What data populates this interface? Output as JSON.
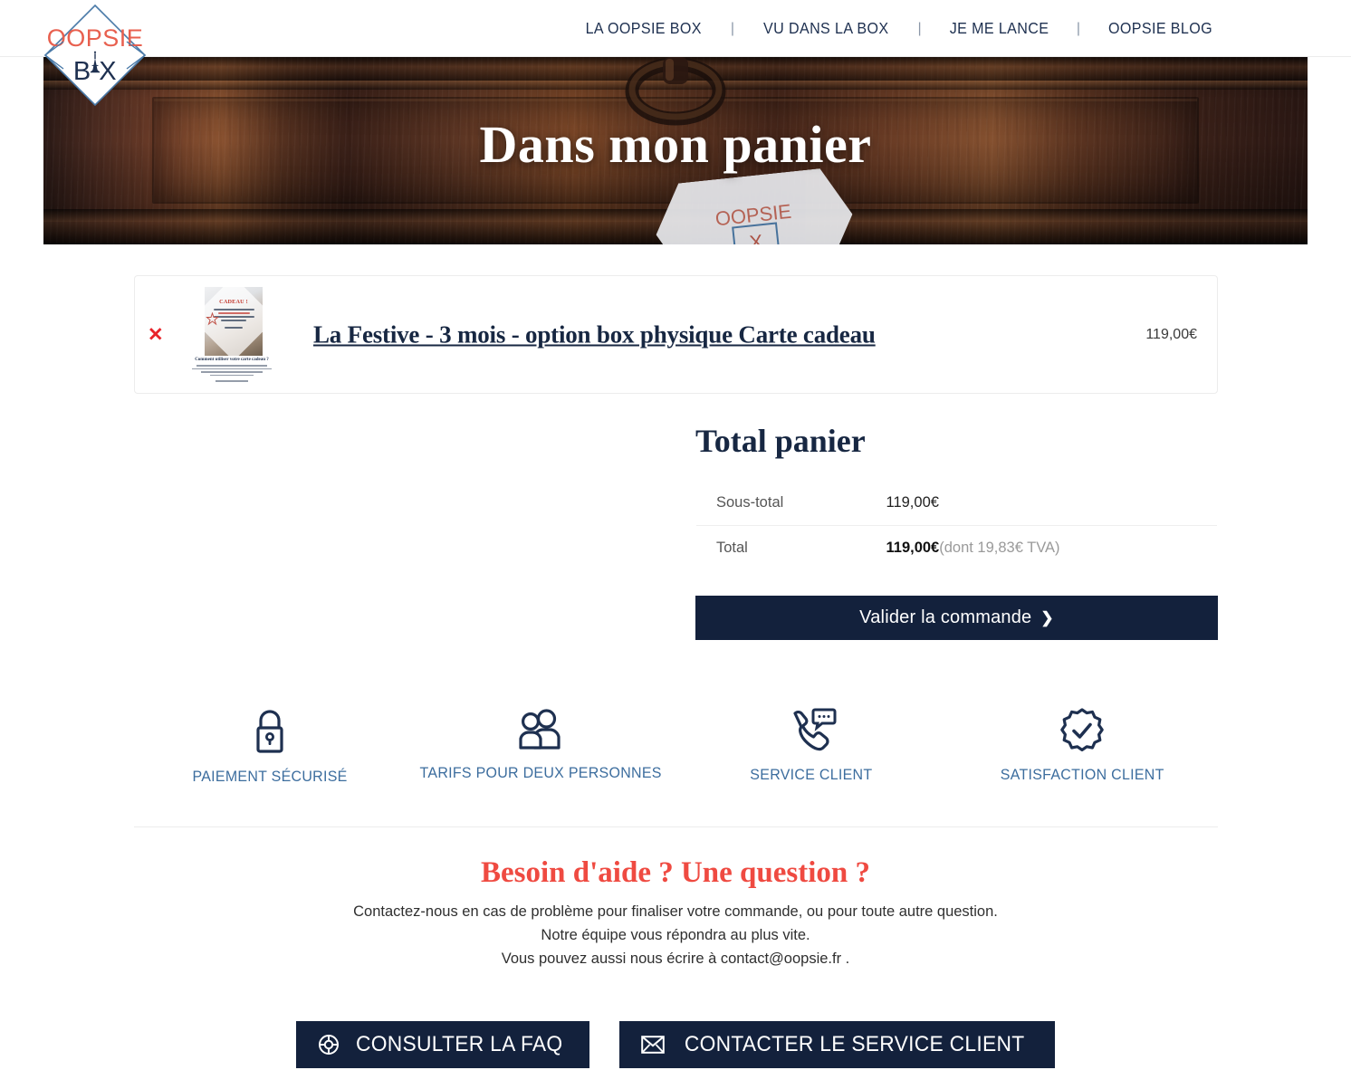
{
  "header": {
    "logo": {
      "top_text": "OOPSIE",
      "bottom_text": "BOX",
      "icon": "eiffel-tower-icon"
    },
    "nav": [
      {
        "label": "LA OOPSIE BOX"
      },
      {
        "label": "VU DANS LA BOX"
      },
      {
        "label": "JE ME LANCE"
      },
      {
        "label": "OOPSIE BLOG"
      }
    ],
    "nav_separator": "|"
  },
  "hero": {
    "title": "Dans mon panier"
  },
  "cart": {
    "remove_label": "✕",
    "item": {
      "title": "La Festive - 3 mois - option box physique Carte cadeau",
      "price": "119,00€",
      "thumbnail": {
        "headline": "CADEAU !",
        "footer_title": "Comment utiliser votre carte cadeau ?"
      }
    }
  },
  "totals": {
    "title": "Total panier",
    "rows": [
      {
        "label": "Sous-total",
        "value": "119,00€",
        "note": ""
      },
      {
        "label": "Total",
        "value": "119,00€",
        "note": "(dont 19,83€ TVA)"
      }
    ],
    "checkout_label": "Valider la commande",
    "checkout_chevron": "❯"
  },
  "trust_badges": [
    {
      "icon": "lock-icon",
      "label": "PAIEMENT SÉCURISÉ"
    },
    {
      "icon": "two-people-icon",
      "label": "TARIFS POUR DEUX PERSONNES"
    },
    {
      "icon": "phone-chat-icon",
      "label": "SERVICE CLIENT"
    },
    {
      "icon": "badge-check-icon",
      "label": "SATISFACTION CLIENT"
    }
  ],
  "help": {
    "title": "Besoin d'aide ? Une question ?",
    "line1": "Contactez-nous en cas de problème pour finaliser votre commande, ou pour toute autre question.",
    "line2": "Notre équipe vous répondra au plus vite.",
    "line3": "Vous pouvez aussi nous écrire à contact@oopsie.fr .",
    "buttons": [
      {
        "icon": "lifebuoy-icon",
        "label": "CONSULTER LA FAQ"
      },
      {
        "icon": "envelope-icon",
        "label": "CONTACTER LE SERVICE CLIENT"
      }
    ]
  },
  "colors": {
    "navy": "#13213c",
    "coral": "#ef4a41",
    "badge_blue": "#3c6d9e",
    "remove_red": "#e8232a"
  }
}
